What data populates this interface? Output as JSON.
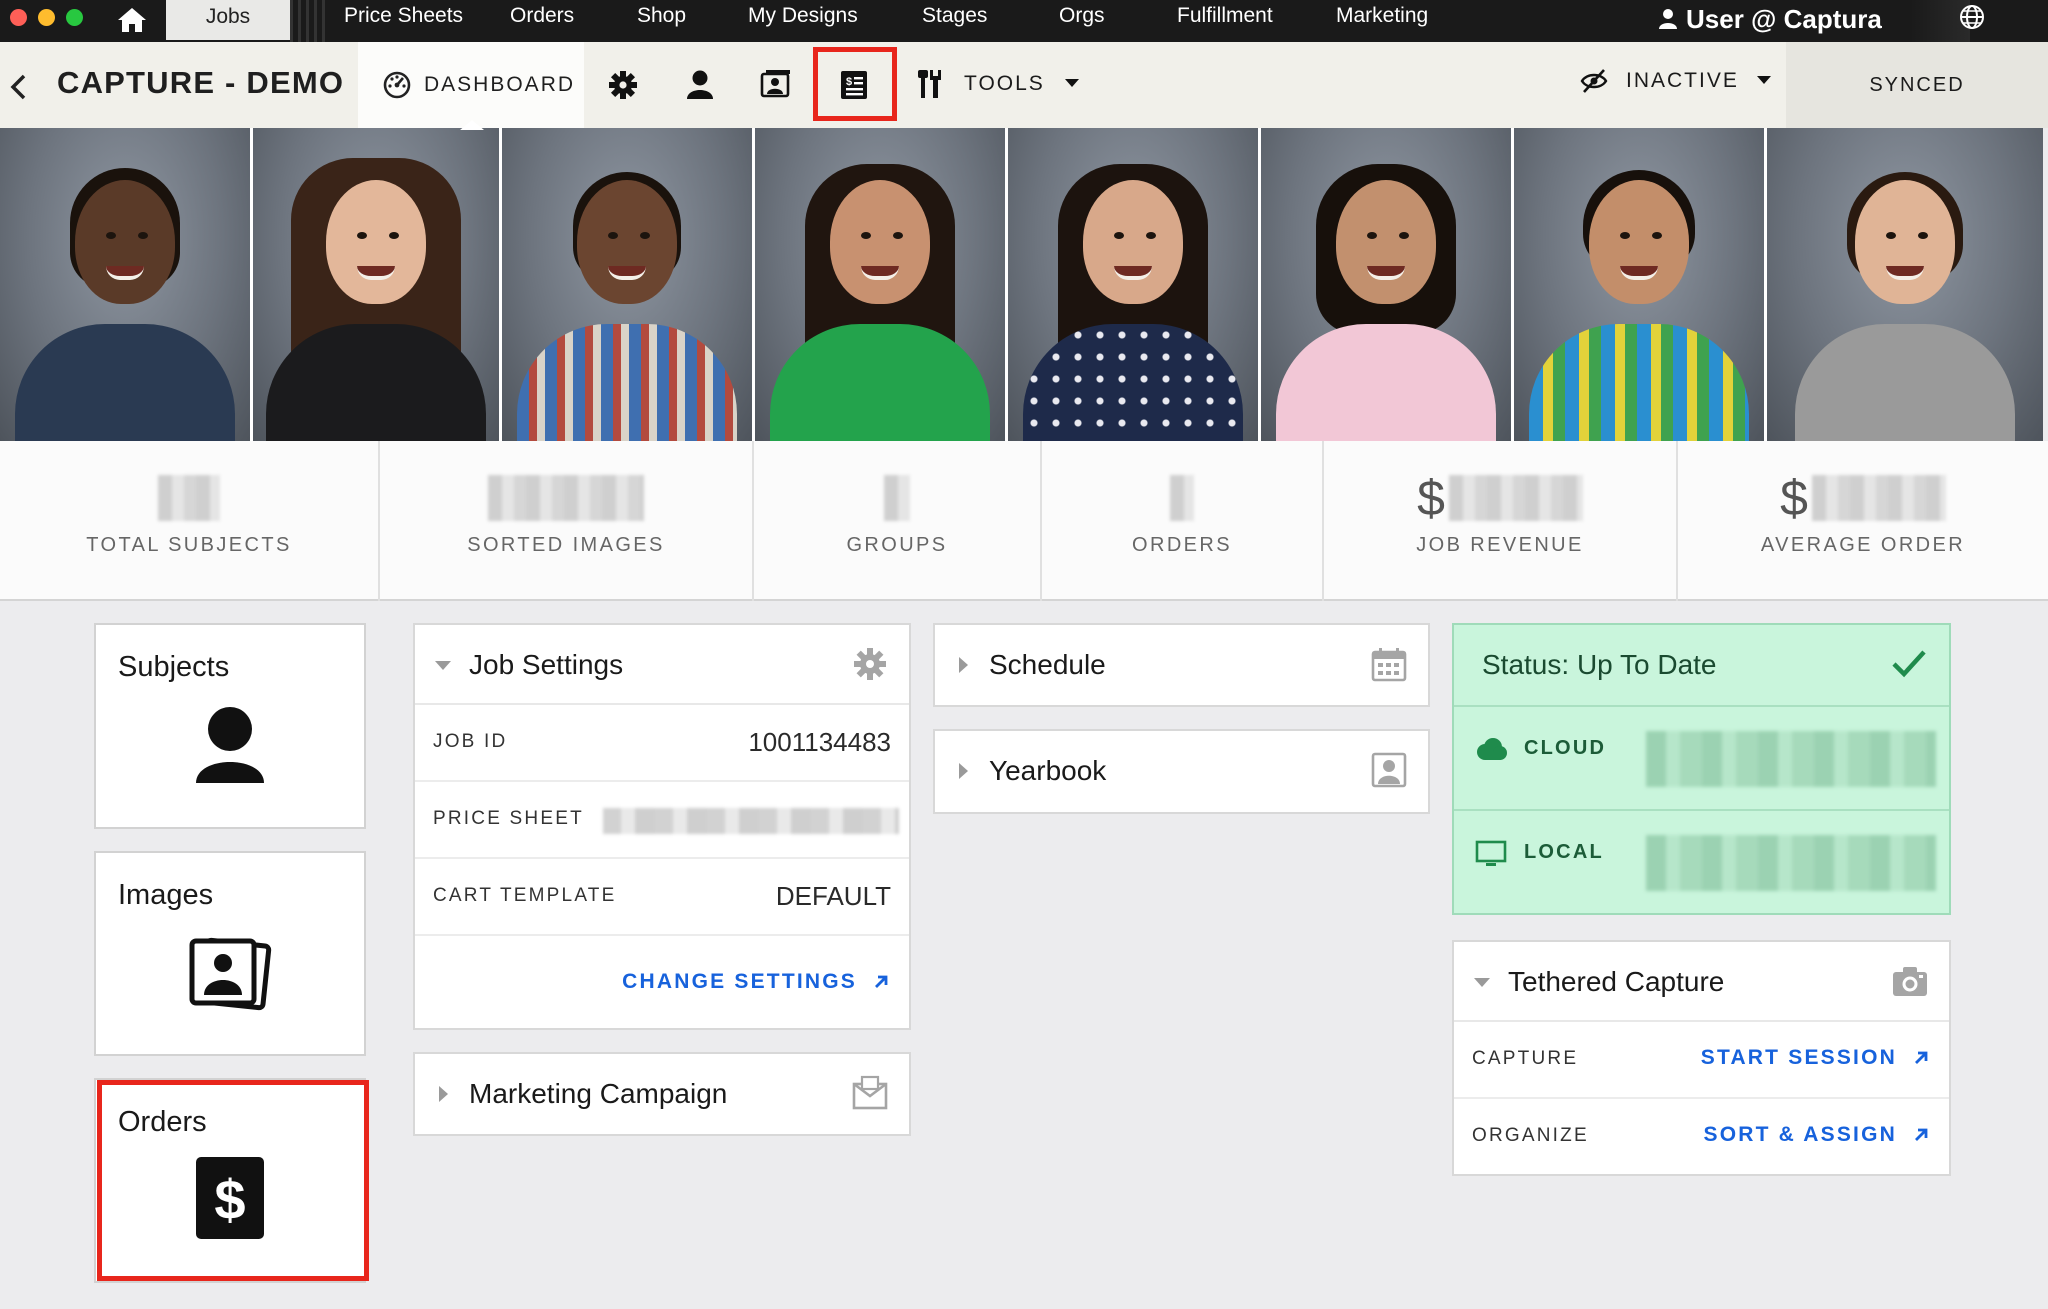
{
  "topnav": {
    "tabs": [
      {
        "label": "Jobs"
      },
      {
        "label": "Price Sheets"
      },
      {
        "label": "Orders"
      },
      {
        "label": "Shop"
      },
      {
        "label": "My Designs"
      },
      {
        "label": "Stages"
      },
      {
        "label": "Orgs"
      },
      {
        "label": "Fulfillment"
      },
      {
        "label": "Marketing"
      }
    ],
    "user": "User @ Captura"
  },
  "toolbar": {
    "job_title": "CAPTURE - DEMO",
    "dashboard_label": "DASHBOARD",
    "tools_label": "TOOLS",
    "inactive_label": "INACTIVE",
    "synced_label": "SYNCED"
  },
  "stats": [
    {
      "label": "TOTAL SUBJECTS"
    },
    {
      "label": "SORTED IMAGES"
    },
    {
      "label": "GROUPS"
    },
    {
      "label": "ORDERS"
    },
    {
      "label": "JOB REVENUE",
      "prefix": "$"
    },
    {
      "label": "AVERAGE ORDER",
      "prefix": "$"
    }
  ],
  "tiles": {
    "subjects": "Subjects",
    "images": "Images",
    "orders": "Orders"
  },
  "job_settings": {
    "title": "Job Settings",
    "rows": [
      {
        "key": "JOB ID",
        "value": "1001134483"
      },
      {
        "key": "PRICE SHEET",
        "value": ""
      },
      {
        "key": "CART TEMPLATE",
        "value": "DEFAULT"
      }
    ],
    "change_link": "CHANGE SETTINGS"
  },
  "marketing_campaign": {
    "title": "Marketing Campaign"
  },
  "schedule": {
    "title": "Schedule"
  },
  "yearbook": {
    "title": "Yearbook"
  },
  "status": {
    "title": "Status: Up To Date",
    "cloud_label": "CLOUD",
    "local_label": "LOCAL"
  },
  "tethered": {
    "title": "Tethered Capture",
    "rows": [
      {
        "key": "CAPTURE",
        "link": "START SESSION"
      },
      {
        "key": "ORGANIZE",
        "link": "SORT & ASSIGN"
      }
    ]
  },
  "colors": {
    "accent_link": "#1762dc",
    "highlight_box": "#e8261c",
    "status_bg": "#c9f5dc"
  }
}
